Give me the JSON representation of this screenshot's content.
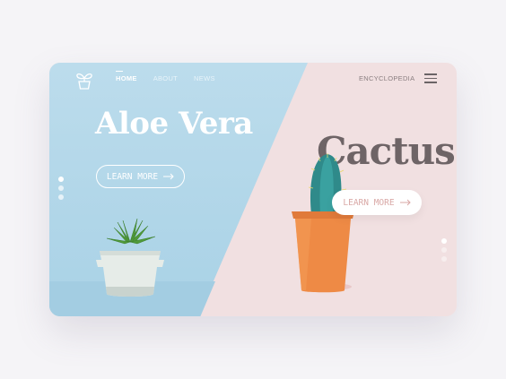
{
  "nav": {
    "items": [
      {
        "label": "HOME",
        "active": true
      },
      {
        "label": "ABOUT",
        "active": false
      },
      {
        "label": "NEWS",
        "active": false
      }
    ],
    "encyclopedia": "ENCYCLOPEDIA"
  },
  "left": {
    "title": "Aloe Vera",
    "button_label": "LEARN MORE",
    "button_icon": "arrow-right-icon",
    "pagination_active": 1
  },
  "right": {
    "title": "Cactus",
    "button_label": "LEARN MORE",
    "button_icon": "arrow-right-icon",
    "pagination_active": 1
  },
  "colors": {
    "left_bg": "#a9d2e6",
    "right_bg": "#f1e0e1",
    "cactus_text": "#6e6466",
    "cactus_button_text": "#d9a8a6"
  }
}
